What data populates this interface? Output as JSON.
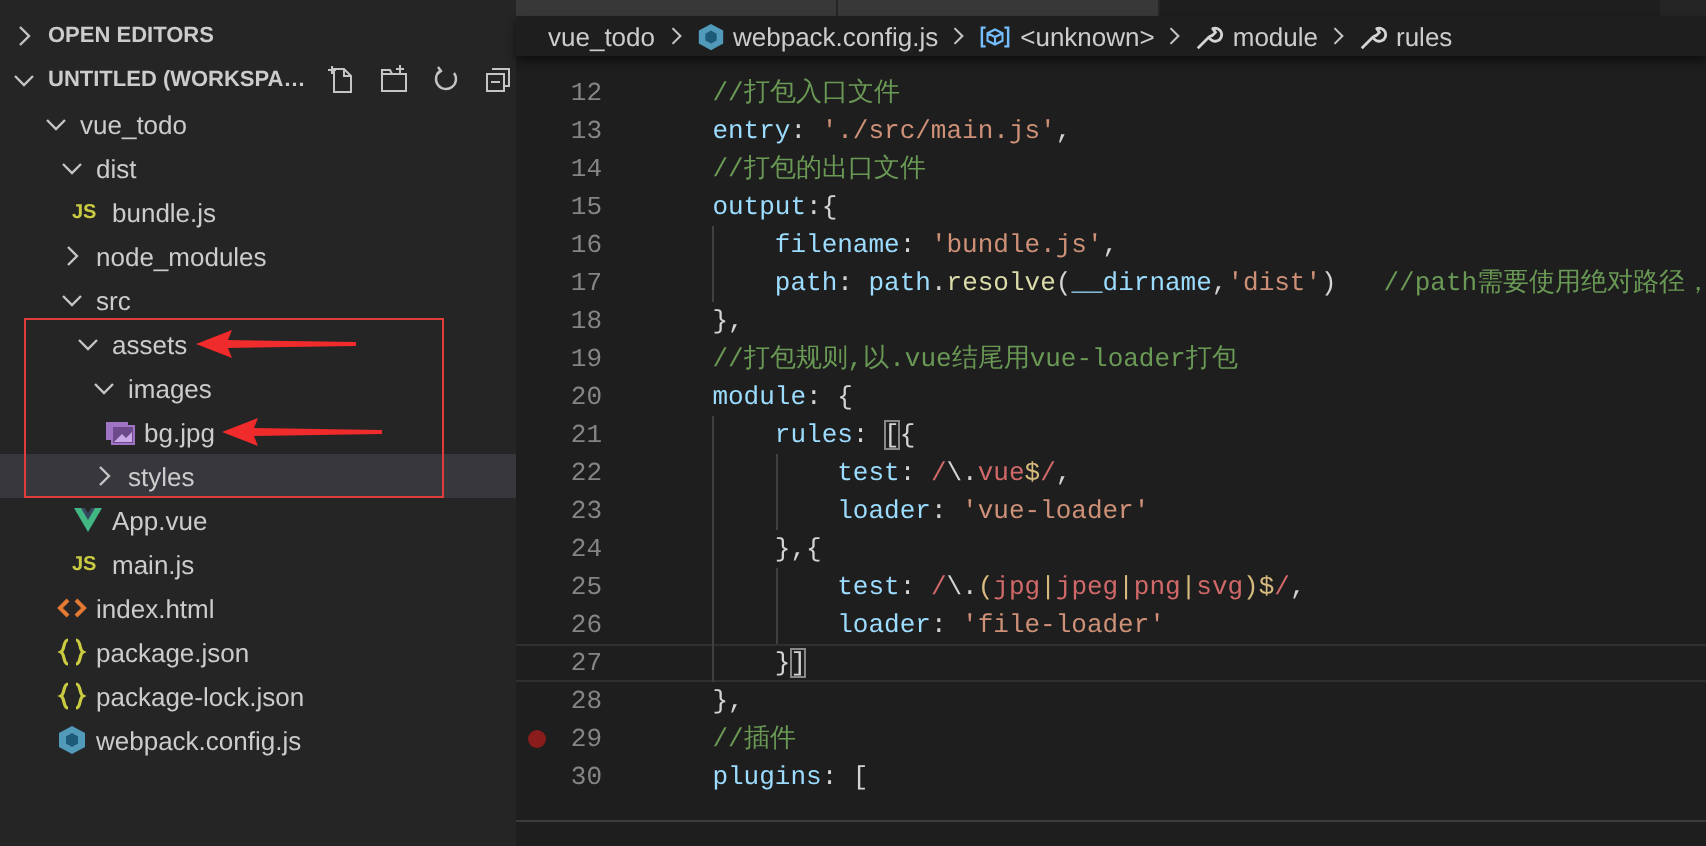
{
  "sidebar": {
    "sections": [
      {
        "title": "OPEN EDITORS",
        "expanded": false
      },
      {
        "title": "UNTITLED (WORKSPA…",
        "expanded": true
      }
    ],
    "tree": [
      {
        "label": "vue_todo",
        "kind": "folder",
        "expanded": true,
        "selected": false,
        "children": [
          {
            "label": "dist",
            "kind": "folder",
            "expanded": true,
            "selected": false,
            "children": [
              {
                "label": "bundle.js",
                "kind": "js",
                "icon_text": "JS",
                "selected": false
              }
            ]
          },
          {
            "label": "node_modules",
            "kind": "folder",
            "expanded": false,
            "selected": false
          },
          {
            "label": "src",
            "kind": "folder",
            "expanded": true,
            "selected": false,
            "children": [
              {
                "label": "assets",
                "kind": "folder",
                "expanded": true,
                "selected": false,
                "boxed": true,
                "arrow": true,
                "children": [
                  {
                    "label": "images",
                    "kind": "folder",
                    "expanded": true,
                    "selected": false,
                    "children": [
                      {
                        "label": "bg.jpg",
                        "kind": "image",
                        "selected": false,
                        "arrow": true
                      }
                    ]
                  },
                  {
                    "label": "styles",
                    "kind": "folder",
                    "expanded": false,
                    "selected": true
                  }
                ]
              },
              {
                "label": "App.vue",
                "kind": "vue",
                "selected": false
              },
              {
                "label": "main.js",
                "kind": "js",
                "icon_text": "JS",
                "selected": false
              }
            ]
          },
          {
            "label": "index.html",
            "kind": "html",
            "selected": false
          },
          {
            "label": "package.json",
            "kind": "json",
            "selected": false
          },
          {
            "label": "package-lock.json",
            "kind": "json",
            "selected": false
          },
          {
            "label": "webpack.config.js",
            "kind": "webpack",
            "selected": false
          }
        ]
      }
    ]
  },
  "editor_tabs": [
    {
      "selected": false
    },
    {
      "selected": false
    },
    {
      "selected": true
    }
  ],
  "breadcrumbs": [
    {
      "label": "vue_todo",
      "kind": "folder"
    },
    {
      "label": "webpack.config.js",
      "kind": "file"
    },
    {
      "label": "<unknown>",
      "kind": "symbol"
    },
    {
      "label": "module",
      "kind": "property"
    },
    {
      "label": "rules",
      "kind": "property"
    }
  ],
  "editor": {
    "lines": [
      {
        "number": "12",
        "current": false,
        "breakpoint": false,
        "tokens": [
          {
            "kind": "comment",
            "text": "    //打包入口文件"
          }
        ]
      },
      {
        "number": "13",
        "current": false,
        "breakpoint": false,
        "tokens": [
          {
            "kind": "key",
            "text": "    entry"
          },
          {
            "kind": "plain",
            "text": ": "
          },
          {
            "kind": "string",
            "text": "'./src/main.js'"
          },
          {
            "kind": "plain",
            "text": ","
          }
        ]
      },
      {
        "number": "14",
        "current": false,
        "breakpoint": false,
        "tokens": [
          {
            "kind": "comment",
            "text": "    //打包的出口文件"
          }
        ]
      },
      {
        "number": "15",
        "current": false,
        "breakpoint": false,
        "tokens": [
          {
            "kind": "key",
            "text": "    output"
          },
          {
            "kind": "plain",
            "text": ":{"
          }
        ]
      },
      {
        "number": "16",
        "current": false,
        "breakpoint": false,
        "tokens": [
          {
            "kind": "key",
            "text": "        filename"
          },
          {
            "kind": "plain",
            "text": ": "
          },
          {
            "kind": "string",
            "text": "'bundle.js'"
          },
          {
            "kind": "plain",
            "text": ","
          }
        ]
      },
      {
        "number": "17",
        "current": false,
        "breakpoint": false,
        "tokens": [
          {
            "kind": "key",
            "text": "        path"
          },
          {
            "kind": "plain",
            "text": ": "
          },
          {
            "kind": "var",
            "text": "path"
          },
          {
            "kind": "plain",
            "text": "."
          },
          {
            "kind": "func",
            "text": "resolve"
          },
          {
            "kind": "plain",
            "text": "("
          },
          {
            "kind": "var",
            "text": "__dirname"
          },
          {
            "kind": "plain",
            "text": ","
          },
          {
            "kind": "string",
            "text": "'dist'"
          },
          {
            "kind": "plain",
            "text": ")   "
          },
          {
            "kind": "comment",
            "text": "//path需要使用绝对路径，"
          }
        ]
      },
      {
        "number": "18",
        "current": false,
        "breakpoint": false,
        "tokens": [
          {
            "kind": "plain",
            "text": "    },"
          }
        ]
      },
      {
        "number": "19",
        "current": false,
        "breakpoint": false,
        "tokens": [
          {
            "kind": "comment",
            "text": "    //打包规则,以.vue结尾用vue-loader打包"
          }
        ]
      },
      {
        "number": "20",
        "current": false,
        "breakpoint": false,
        "tokens": [
          {
            "kind": "key",
            "text": "    module"
          },
          {
            "kind": "plain",
            "text": ": {"
          }
        ]
      },
      {
        "number": "21",
        "current": false,
        "breakpoint": false,
        "tokens": [
          {
            "kind": "key",
            "text": "        rules"
          },
          {
            "kind": "plain",
            "text": ": "
          },
          {
            "kind": "bracket",
            "text": "["
          },
          {
            "kind": "plain",
            "text": "{"
          }
        ]
      },
      {
        "number": "22",
        "current": false,
        "breakpoint": false,
        "tokens": [
          {
            "kind": "key",
            "text": "            test"
          },
          {
            "kind": "plain",
            "text": ": "
          },
          {
            "kind": "regex",
            "text": "/"
          },
          {
            "kind": "plain",
            "text": "\\."
          },
          {
            "kind": "regex",
            "text": "vue"
          },
          {
            "kind": "regex-op",
            "text": "$"
          },
          {
            "kind": "regex",
            "text": "/"
          },
          {
            "kind": "plain",
            "text": ","
          }
        ]
      },
      {
        "number": "23",
        "current": false,
        "breakpoint": false,
        "tokens": [
          {
            "kind": "key",
            "text": "            loader"
          },
          {
            "kind": "plain",
            "text": ": "
          },
          {
            "kind": "string",
            "text": "'vue-loader'"
          }
        ]
      },
      {
        "number": "24",
        "current": false,
        "breakpoint": false,
        "tokens": [
          {
            "kind": "plain",
            "text": "        },{"
          }
        ]
      },
      {
        "number": "25",
        "current": false,
        "breakpoint": false,
        "tokens": [
          {
            "kind": "key",
            "text": "            test"
          },
          {
            "kind": "plain",
            "text": ": "
          },
          {
            "kind": "regex",
            "text": "/"
          },
          {
            "kind": "plain",
            "text": "\\."
          },
          {
            "kind": "regex-op",
            "text": "("
          },
          {
            "kind": "regex",
            "text": "jpg"
          },
          {
            "kind": "regex-op",
            "text": "|"
          },
          {
            "kind": "regex",
            "text": "jpeg"
          },
          {
            "kind": "regex-op",
            "text": "|"
          },
          {
            "kind": "regex",
            "text": "png"
          },
          {
            "kind": "regex-op",
            "text": "|"
          },
          {
            "kind": "regex",
            "text": "svg"
          },
          {
            "kind": "regex-op",
            "text": ")$"
          },
          {
            "kind": "regex",
            "text": "/"
          },
          {
            "kind": "plain",
            "text": ","
          }
        ]
      },
      {
        "number": "26",
        "current": false,
        "breakpoint": false,
        "tokens": [
          {
            "kind": "key",
            "text": "            loader"
          },
          {
            "kind": "plain",
            "text": ": "
          },
          {
            "kind": "string",
            "text": "'file-loader'"
          }
        ]
      },
      {
        "number": "27",
        "current": true,
        "breakpoint": false,
        "tokens": [
          {
            "kind": "plain",
            "text": "        }"
          },
          {
            "kind": "bracket",
            "text": "]"
          }
        ]
      },
      {
        "number": "28",
        "current": false,
        "breakpoint": false,
        "tokens": [
          {
            "kind": "plain",
            "text": "    },"
          }
        ]
      },
      {
        "number": "29",
        "current": false,
        "breakpoint": true,
        "tokens": [
          {
            "kind": "comment",
            "text": "    //插件"
          }
        ]
      },
      {
        "number": "30",
        "current": false,
        "breakpoint": false,
        "tokens": [
          {
            "kind": "key",
            "text": "    plugins"
          },
          {
            "kind": "plain",
            "text": ": ["
          }
        ]
      }
    ]
  }
}
